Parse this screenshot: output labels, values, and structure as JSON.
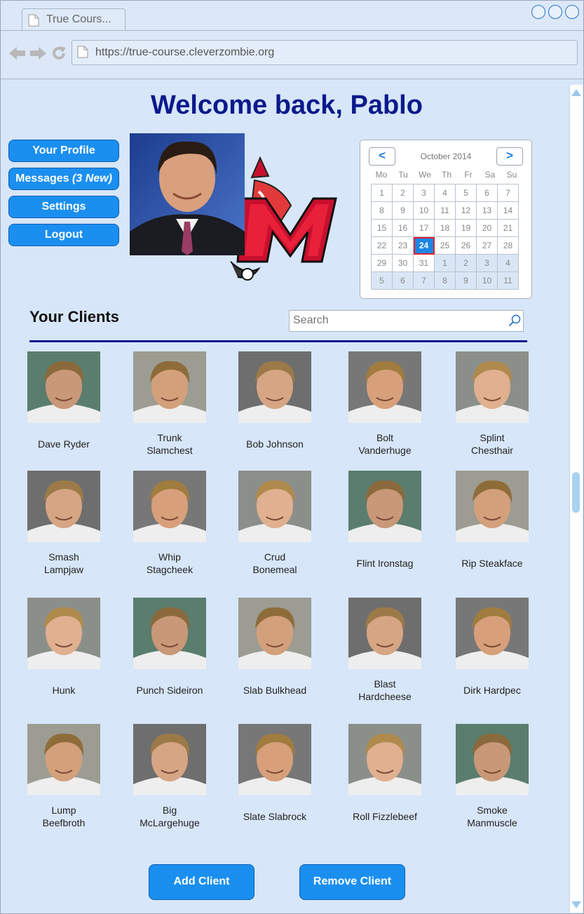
{
  "browser": {
    "tab_title": "True Cours...",
    "url": "https://true-course.cleverzombie.org"
  },
  "page": {
    "welcome": "Welcome back, Pablo"
  },
  "sidebar": {
    "profile_label": "Your Profile",
    "messages_label": "Messages",
    "messages_badge": "(3 New)",
    "settings_label": "Settings",
    "logout_label": "Logout"
  },
  "calendar": {
    "prev": "<",
    "next": ">",
    "month": "October 2014",
    "days_of_week": [
      "Mo",
      "Tu",
      "We",
      "Th",
      "Fr",
      "Sa",
      "Su"
    ],
    "selected_day": "24",
    "weeks": [
      [
        "1",
        "2",
        "3",
        "4",
        "5",
        "6",
        "7"
      ],
      [
        "8",
        "9",
        "10",
        "11",
        "12",
        "13",
        "14"
      ],
      [
        "15",
        "16",
        "17",
        "18",
        "19",
        "20",
        "21"
      ],
      [
        "22",
        "23",
        "24",
        "25",
        "26",
        "27",
        "28"
      ],
      [
        "29",
        "30",
        "31",
        "1",
        "2",
        "3",
        "4"
      ],
      [
        "5",
        "6",
        "7",
        "8",
        "9",
        "10",
        "11"
      ]
    ]
  },
  "clients_section": {
    "title": "Your Clients",
    "search_placeholder": "Search"
  },
  "clients": [
    {
      "line1": "Dave Ryder",
      "line2": ""
    },
    {
      "line1": "Trunk",
      "line2": "Slamchest"
    },
    {
      "line1": "Bob Johnson",
      "line2": ""
    },
    {
      "line1": "Bolt",
      "line2": "Vanderhuge"
    },
    {
      "line1": "Splint",
      "line2": "Chesthair"
    },
    {
      "line1": "Smash",
      "line2": "Lampjaw"
    },
    {
      "line1": "Whip",
      "line2": "Stagcheek"
    },
    {
      "line1": "Crud",
      "line2": "Bonemeal"
    },
    {
      "line1": "Flint Ironstag",
      "line2": ""
    },
    {
      "line1": "Rip Steakface",
      "line2": ""
    },
    {
      "line1": "Hunk",
      "line2": ""
    },
    {
      "line1": "Punch Sideiron",
      "line2": ""
    },
    {
      "line1": "Slab Bulkhead",
      "line2": ""
    },
    {
      "line1": "Blast",
      "line2": "Hardcheese"
    },
    {
      "line1": "Dirk Hardpec",
      "line2": ""
    },
    {
      "line1": "Lump",
      "line2": "Beefbroth"
    },
    {
      "line1": "Big",
      "line2": "McLargehuge"
    },
    {
      "line1": "Slate Slabrock",
      "line2": ""
    },
    {
      "line1": "Roll Fizzlebeef",
      "line2": ""
    },
    {
      "line1": "Smoke",
      "line2": "Manmuscle"
    }
  ],
  "actions": {
    "add_label": "Add Client",
    "remove_label": "Remove Client"
  },
  "colors": {
    "accent": "#1a8ff0",
    "title": "#0a1a8c",
    "background": "#d7e6f8",
    "today_border": "#e0242a"
  }
}
